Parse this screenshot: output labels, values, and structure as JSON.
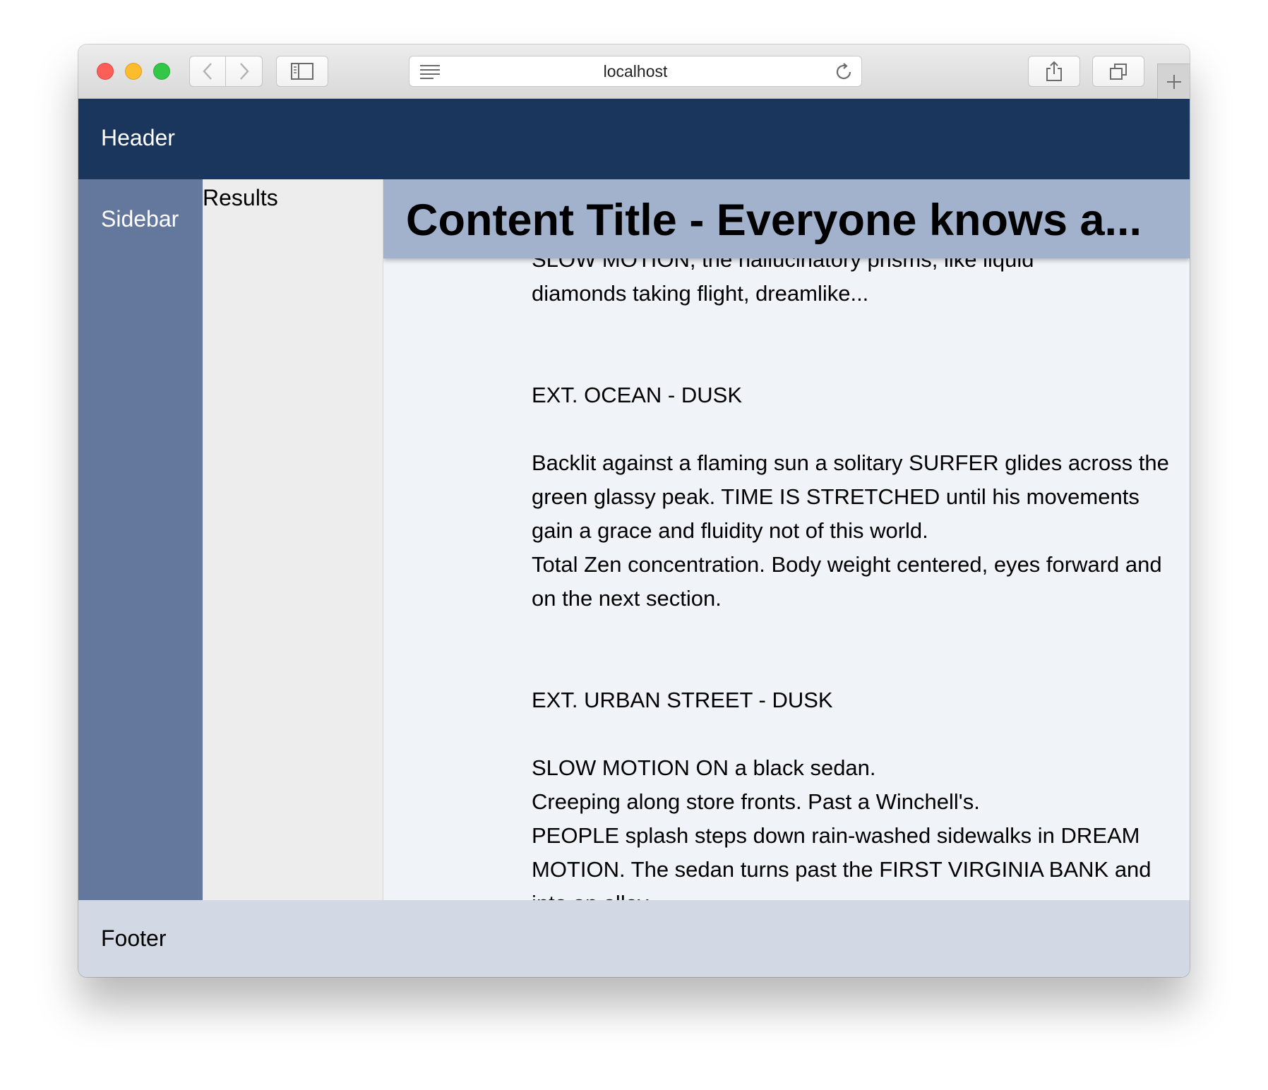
{
  "browser": {
    "url": "localhost",
    "icons": {
      "back": "chevron-left-icon",
      "forward": "chevron-right-icon",
      "sidebar": "sidebar-icon",
      "reader": "reader-lines-icon",
      "reload": "reload-icon",
      "share": "share-icon",
      "tabs": "tabs-overview-icon",
      "new_tab": "plus-icon"
    }
  },
  "page": {
    "header": "Header",
    "sidebar": "Sidebar",
    "results": "Results",
    "content_title": "Content Title - Everyone knows a...",
    "script": {
      "cut_line": "SLOW MOTION, the hallucinatory prisms, like liquid",
      "line_1": "diamonds taking flight, dreamlike...",
      "scene_1": "EXT. OCEAN - DUSK",
      "para_1": "Backlit against a flaming sun a solitary SURFER glides across the green glassy peak. TIME IS STRETCHED until his movements gain a grace and fluidity not of this world.",
      "para_2": "Total Zen concentration. Body weight centered, eyes forward and on the next section.",
      "scene_2": "EXT. URBAN STREET - DUSK",
      "para_3": "SLOW MOTION ON a black sedan.",
      "para_4": "Creeping along store fronts. Past a Winchell's.",
      "para_5": "PEOPLE splash steps down rain-washed sidewalks in DREAM MOTION. The sedan turns past the FIRST VIRGINIA BANK and into an alley."
    },
    "footer": "Footer"
  },
  "colors": {
    "header_bg": "#1b365c",
    "sidebar_bg": "#64789e",
    "results_bg": "#ededed",
    "content_bg": "#f0f3f7",
    "title_bg": "#a2b1cc",
    "footer_bg": "#d2d9e5"
  }
}
